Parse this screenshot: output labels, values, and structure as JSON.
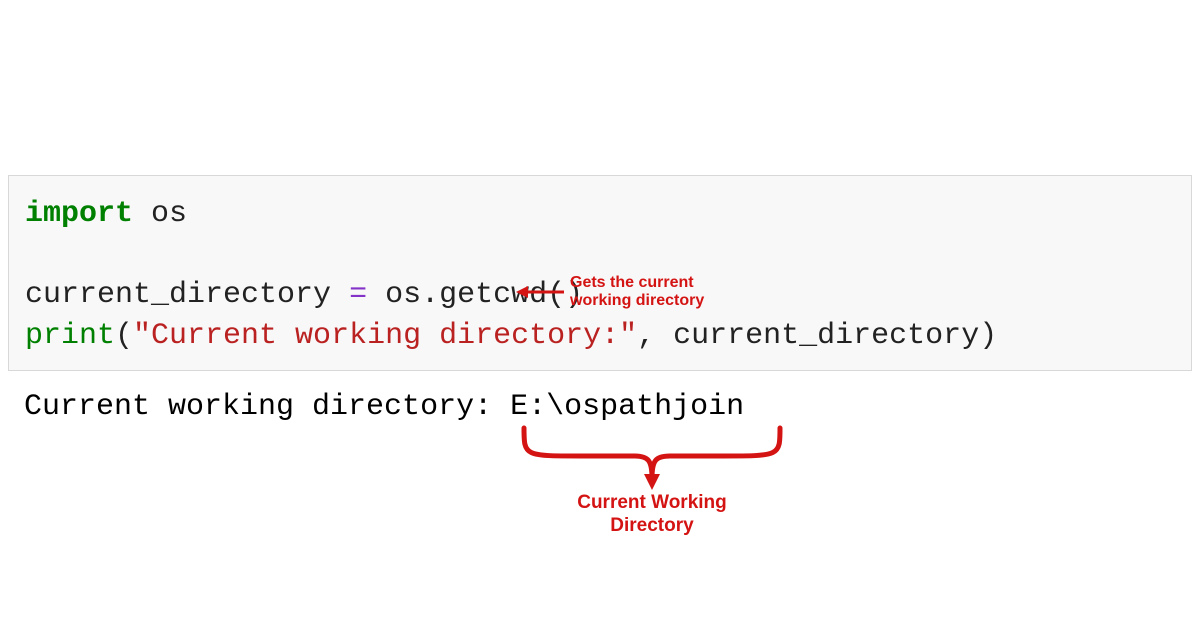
{
  "code": {
    "kw_import": "import",
    "module": " os",
    "blank": " ",
    "line2_lhs": "current_directory ",
    "line2_eq": "=",
    "line2_rhs": " os.getcwd()",
    "line3_print": "print",
    "line3_open": "(",
    "line3_str": "\"Current working directory:\"",
    "line3_comma": ", ",
    "line3_arg": "current_directory",
    "line3_close": ")"
  },
  "output": {
    "text": "Current working directory: E:\\ospathjoin"
  },
  "annotations": {
    "arrow_line1": "Gets the current",
    "arrow_line2": "working directory",
    "brace_line1": "Current Working",
    "brace_line2": "Directory"
  },
  "colors": {
    "annot": "#d41313"
  }
}
